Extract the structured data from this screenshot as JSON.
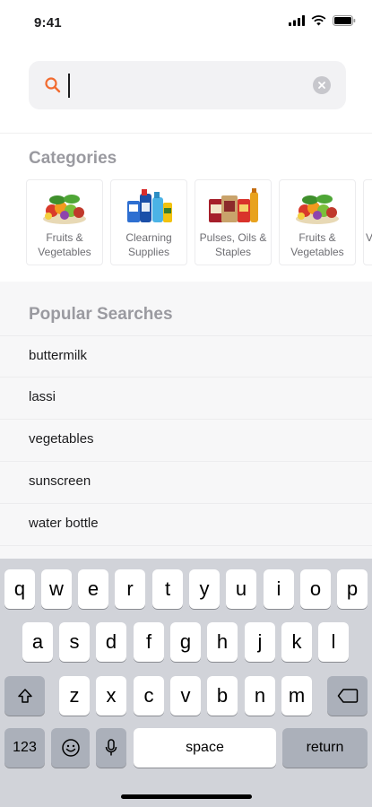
{
  "status_bar": {
    "time": "9:41"
  },
  "search": {
    "placeholder": "",
    "value": ""
  },
  "categories_title": "Categories",
  "categories": [
    {
      "label": "Fruits & Vegetables",
      "icon": "fruits-vegetables-image"
    },
    {
      "label": "Clearning Supplies",
      "icon": "cleaning-supplies-image"
    },
    {
      "label": "Pulses, Oils & Staples",
      "icon": "pulses-oils-staples-image"
    },
    {
      "label": "Fruits & Vegetables",
      "icon": "fruits-vegetables-image"
    },
    {
      "label": "V",
      "icon": "partial-category-image"
    }
  ],
  "popular_title": "Popular Searches",
  "popular_searches": [
    "buttermilk",
    "lassi",
    "vegetables",
    "sunscreen",
    "water bottle"
  ],
  "keyboard": {
    "row1": [
      "q",
      "w",
      "e",
      "r",
      "t",
      "y",
      "u",
      "i",
      "o",
      "p"
    ],
    "row2": [
      "a",
      "s",
      "d",
      "f",
      "g",
      "h",
      "j",
      "k",
      "l"
    ],
    "row3": [
      "z",
      "x",
      "c",
      "v",
      "b",
      "n",
      "m"
    ],
    "numbers": "123",
    "space": "space",
    "return": "return"
  },
  "colors": {
    "accent": "#f26b2f",
    "section_title": "#9a9aa0",
    "keyboard_bg": "#d1d3d9"
  }
}
